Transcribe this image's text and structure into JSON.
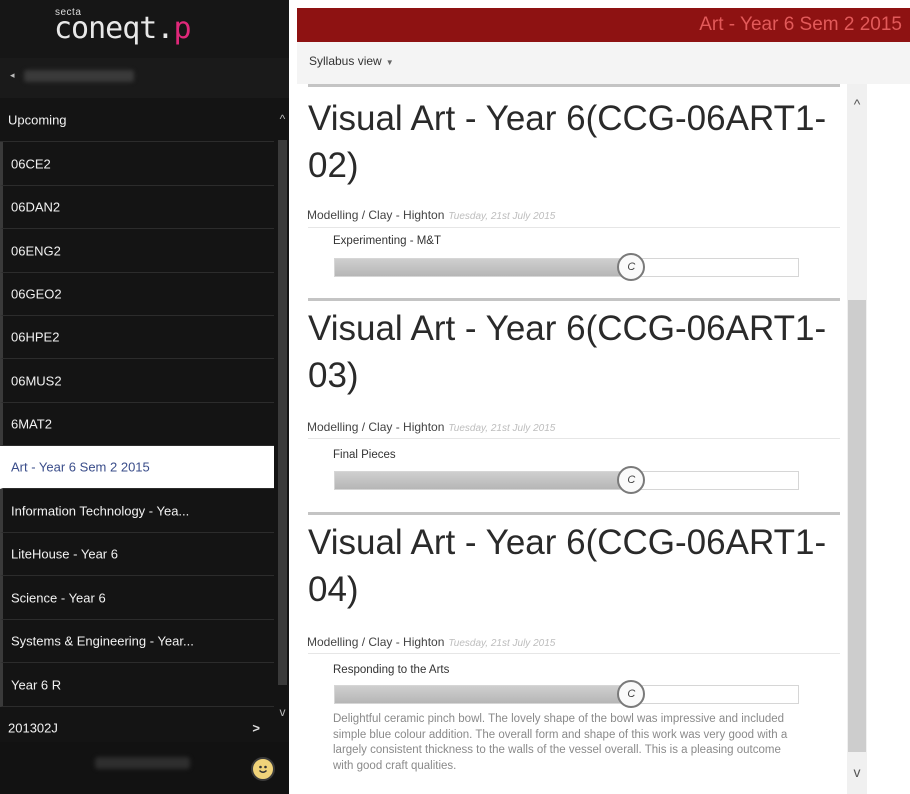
{
  "logo": {
    "brand_small": "secta",
    "brand_main": "coneqt.",
    "brand_accent": "p"
  },
  "user": {
    "back_glyph": "◂"
  },
  "nav": {
    "items": [
      {
        "label": "Upcoming",
        "type": "top"
      },
      {
        "label": "06CE2",
        "type": "course"
      },
      {
        "label": "06DAN2",
        "type": "course"
      },
      {
        "label": "06ENG2",
        "type": "course"
      },
      {
        "label": "06GEO2",
        "type": "course"
      },
      {
        "label": "06HPE2",
        "type": "course"
      },
      {
        "label": "06MUS2",
        "type": "course"
      },
      {
        "label": "6MAT2",
        "type": "course"
      },
      {
        "label": "Art - Year 6 Sem 2 2015",
        "type": "course",
        "active": true
      },
      {
        "label": "Information Technology - Yea...",
        "type": "course"
      },
      {
        "label": "LiteHouse - Year 6",
        "type": "course"
      },
      {
        "label": "Science - Year 6",
        "type": "course"
      },
      {
        "label": "Systems & Engineering - Year...",
        "type": "course"
      },
      {
        "label": "Year 6 R",
        "type": "course"
      },
      {
        "label": "201302J",
        "type": "top",
        "arrow": ">"
      }
    ]
  },
  "header": {
    "title": "Art - Year 6 Sem 2 2015",
    "view_selector": "Syllabus view",
    "view_caret": "▼"
  },
  "lessons": [
    {
      "title": "Visual Art - Year 6(CCG-06ART1-02)",
      "category": "Modelling / Clay - Highton",
      "date": "Tuesday, 21st July 2015",
      "task": "Experimenting - M&T",
      "grade": "C",
      "progress": 0.64
    },
    {
      "title": "Visual Art - Year 6(CCG-06ART1-03)",
      "category": "Modelling / Clay - Highton",
      "date": "Tuesday, 21st July 2015",
      "task": "Final Pieces",
      "grade": "C",
      "progress": 0.64
    },
    {
      "title": "Visual Art - Year 6(CCG-06ART1-04)",
      "category": "Modelling / Clay - Highton",
      "date": "Tuesday, 21st July 2015",
      "task": "Responding to the Arts",
      "grade": "C",
      "progress": 0.64,
      "comment": "Delightful ceramic pinch bowl. The lovely shape of the bowl was impressive and included simple blue colour addition. The overall form and shape of this work was very good with a largely consistent thickness to the walls of the vessel overall. This is a pleasing outcome with good craft qualities."
    }
  ],
  "icons": {
    "scroll_up": "^",
    "scroll_down": "v",
    "smiley": "smiley-icon"
  },
  "colors": {
    "header_bg": "#8e1212",
    "header_text": "#e25a5a",
    "active_nav_text": "#3a4d8a",
    "brand_accent": "#e0287a"
  }
}
